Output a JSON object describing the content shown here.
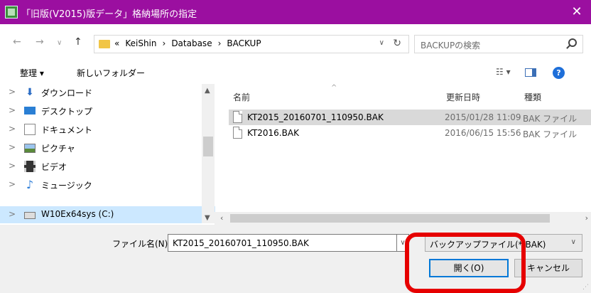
{
  "window": {
    "title": "「旧版(V2015)版データ」格納場所の指定",
    "close": "✕"
  },
  "nav": {
    "back": "←",
    "forward": "→",
    "recent": "∨",
    "up": "↑",
    "crumbs": [
      "«",
      "KeiShin",
      "›",
      "Database",
      "›",
      "BACKUP"
    ],
    "address_dropdown": "∨",
    "refresh": "↻",
    "search_placeholder": "BACKUPの検索"
  },
  "toolbar": {
    "organize": "整理 ▾",
    "new_folder": "新しいフォルダー",
    "view": "☷ ▾",
    "help": "?"
  },
  "tree": {
    "items": [
      {
        "chev": ">",
        "label": "ダウンロード",
        "icon": "download-icon"
      },
      {
        "chev": ">",
        "label": "デスクトップ",
        "icon": "desktop-icon"
      },
      {
        "chev": ">",
        "label": "ドキュメント",
        "icon": "document-icon"
      },
      {
        "chev": ">",
        "label": "ピクチャ",
        "icon": "picture-icon"
      },
      {
        "chev": ">",
        "label": "ビデオ",
        "icon": "video-icon"
      },
      {
        "chev": ">",
        "label": "ミュージック",
        "icon": "music-icon"
      },
      {
        "chev": ">",
        "label": "W10Ex64sys (C:)",
        "icon": "drive-icon",
        "selected": true
      }
    ]
  },
  "columns": {
    "name": "名前",
    "modified": "更新日時",
    "type": "種類"
  },
  "files": [
    {
      "name": "KT2015_20160701_110950.BAK",
      "modified": "2015/01/28 11:09",
      "type": "BAK ファイル",
      "selected": true
    },
    {
      "name": "KT2016.BAK",
      "modified": "2016/06/15 15:56",
      "type": "BAK ファイル"
    }
  ],
  "bottom": {
    "filename_label": "ファイル名(N):",
    "filename_value": "KT2015_20160701_110950.BAK",
    "filetype_value": "バックアップファイル(*.BAK)",
    "open_label": "開く(O)",
    "cancel_label": "キャンセル"
  },
  "colors": {
    "titlebar": "#9b0fa0",
    "highlight": "#e60000",
    "selection": "#cce8ff"
  }
}
